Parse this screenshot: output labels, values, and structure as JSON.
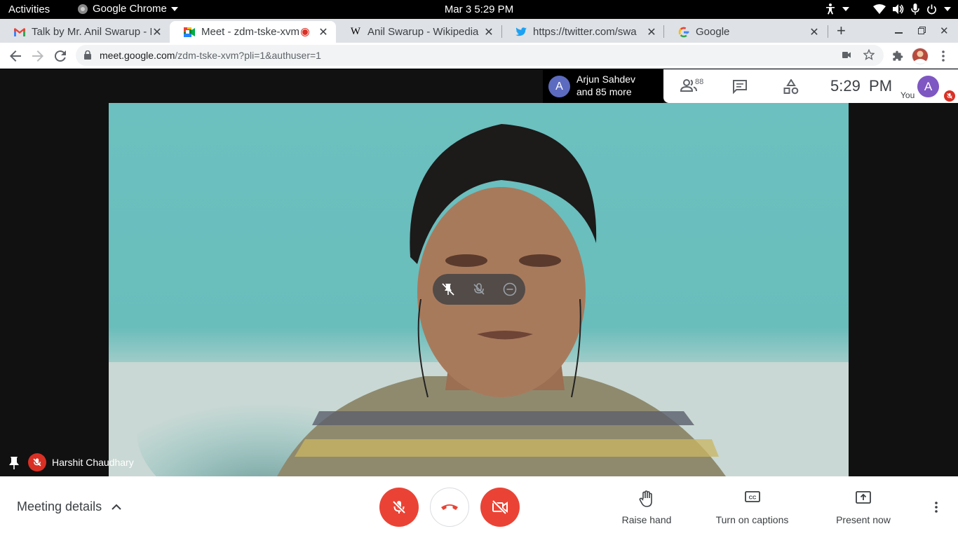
{
  "system_bar": {
    "activities": "Activities",
    "app_name": "Google Chrome",
    "datetime": "Mar 3   5:29 PM"
  },
  "tabs": [
    {
      "title": "Talk by Mr. Anil Swarup - I",
      "favicon": "gmail-icon",
      "active": false
    },
    {
      "title": "Meet - zdm-tske-xvm",
      "favicon": "google-meet-icon",
      "active": true,
      "recording": true
    },
    {
      "title": "Anil Swarup - Wikipedia",
      "favicon": "wikipedia-icon",
      "active": false
    },
    {
      "title": "https://twitter.com/swa",
      "favicon": "twitter-icon",
      "active": false
    },
    {
      "title": "Google",
      "favicon": "google-icon",
      "active": false
    }
  ],
  "address_bar": {
    "domain": "meet.google.com",
    "path": "/zdm-tske-xvm?pli=1&authuser=1"
  },
  "meet": {
    "speaker_avatar_letter": "A",
    "speaker_line1": "Arjun Sahdev",
    "speaker_line2": "and 85 more",
    "participant_count": "88",
    "clock": "5:29  PM",
    "self_label": "You",
    "self_avatar_letter": "A",
    "tile_name": "Harshit Chaudhary",
    "meeting_details": "Meeting details",
    "actions": {
      "raise_hand": "Raise hand",
      "captions": "Turn on captions",
      "present": "Present now"
    }
  },
  "colors": {
    "meet_red": "#ea4335",
    "avatar_purple": "#7e57c2",
    "speaker_avatar": "#5c6bc0"
  }
}
